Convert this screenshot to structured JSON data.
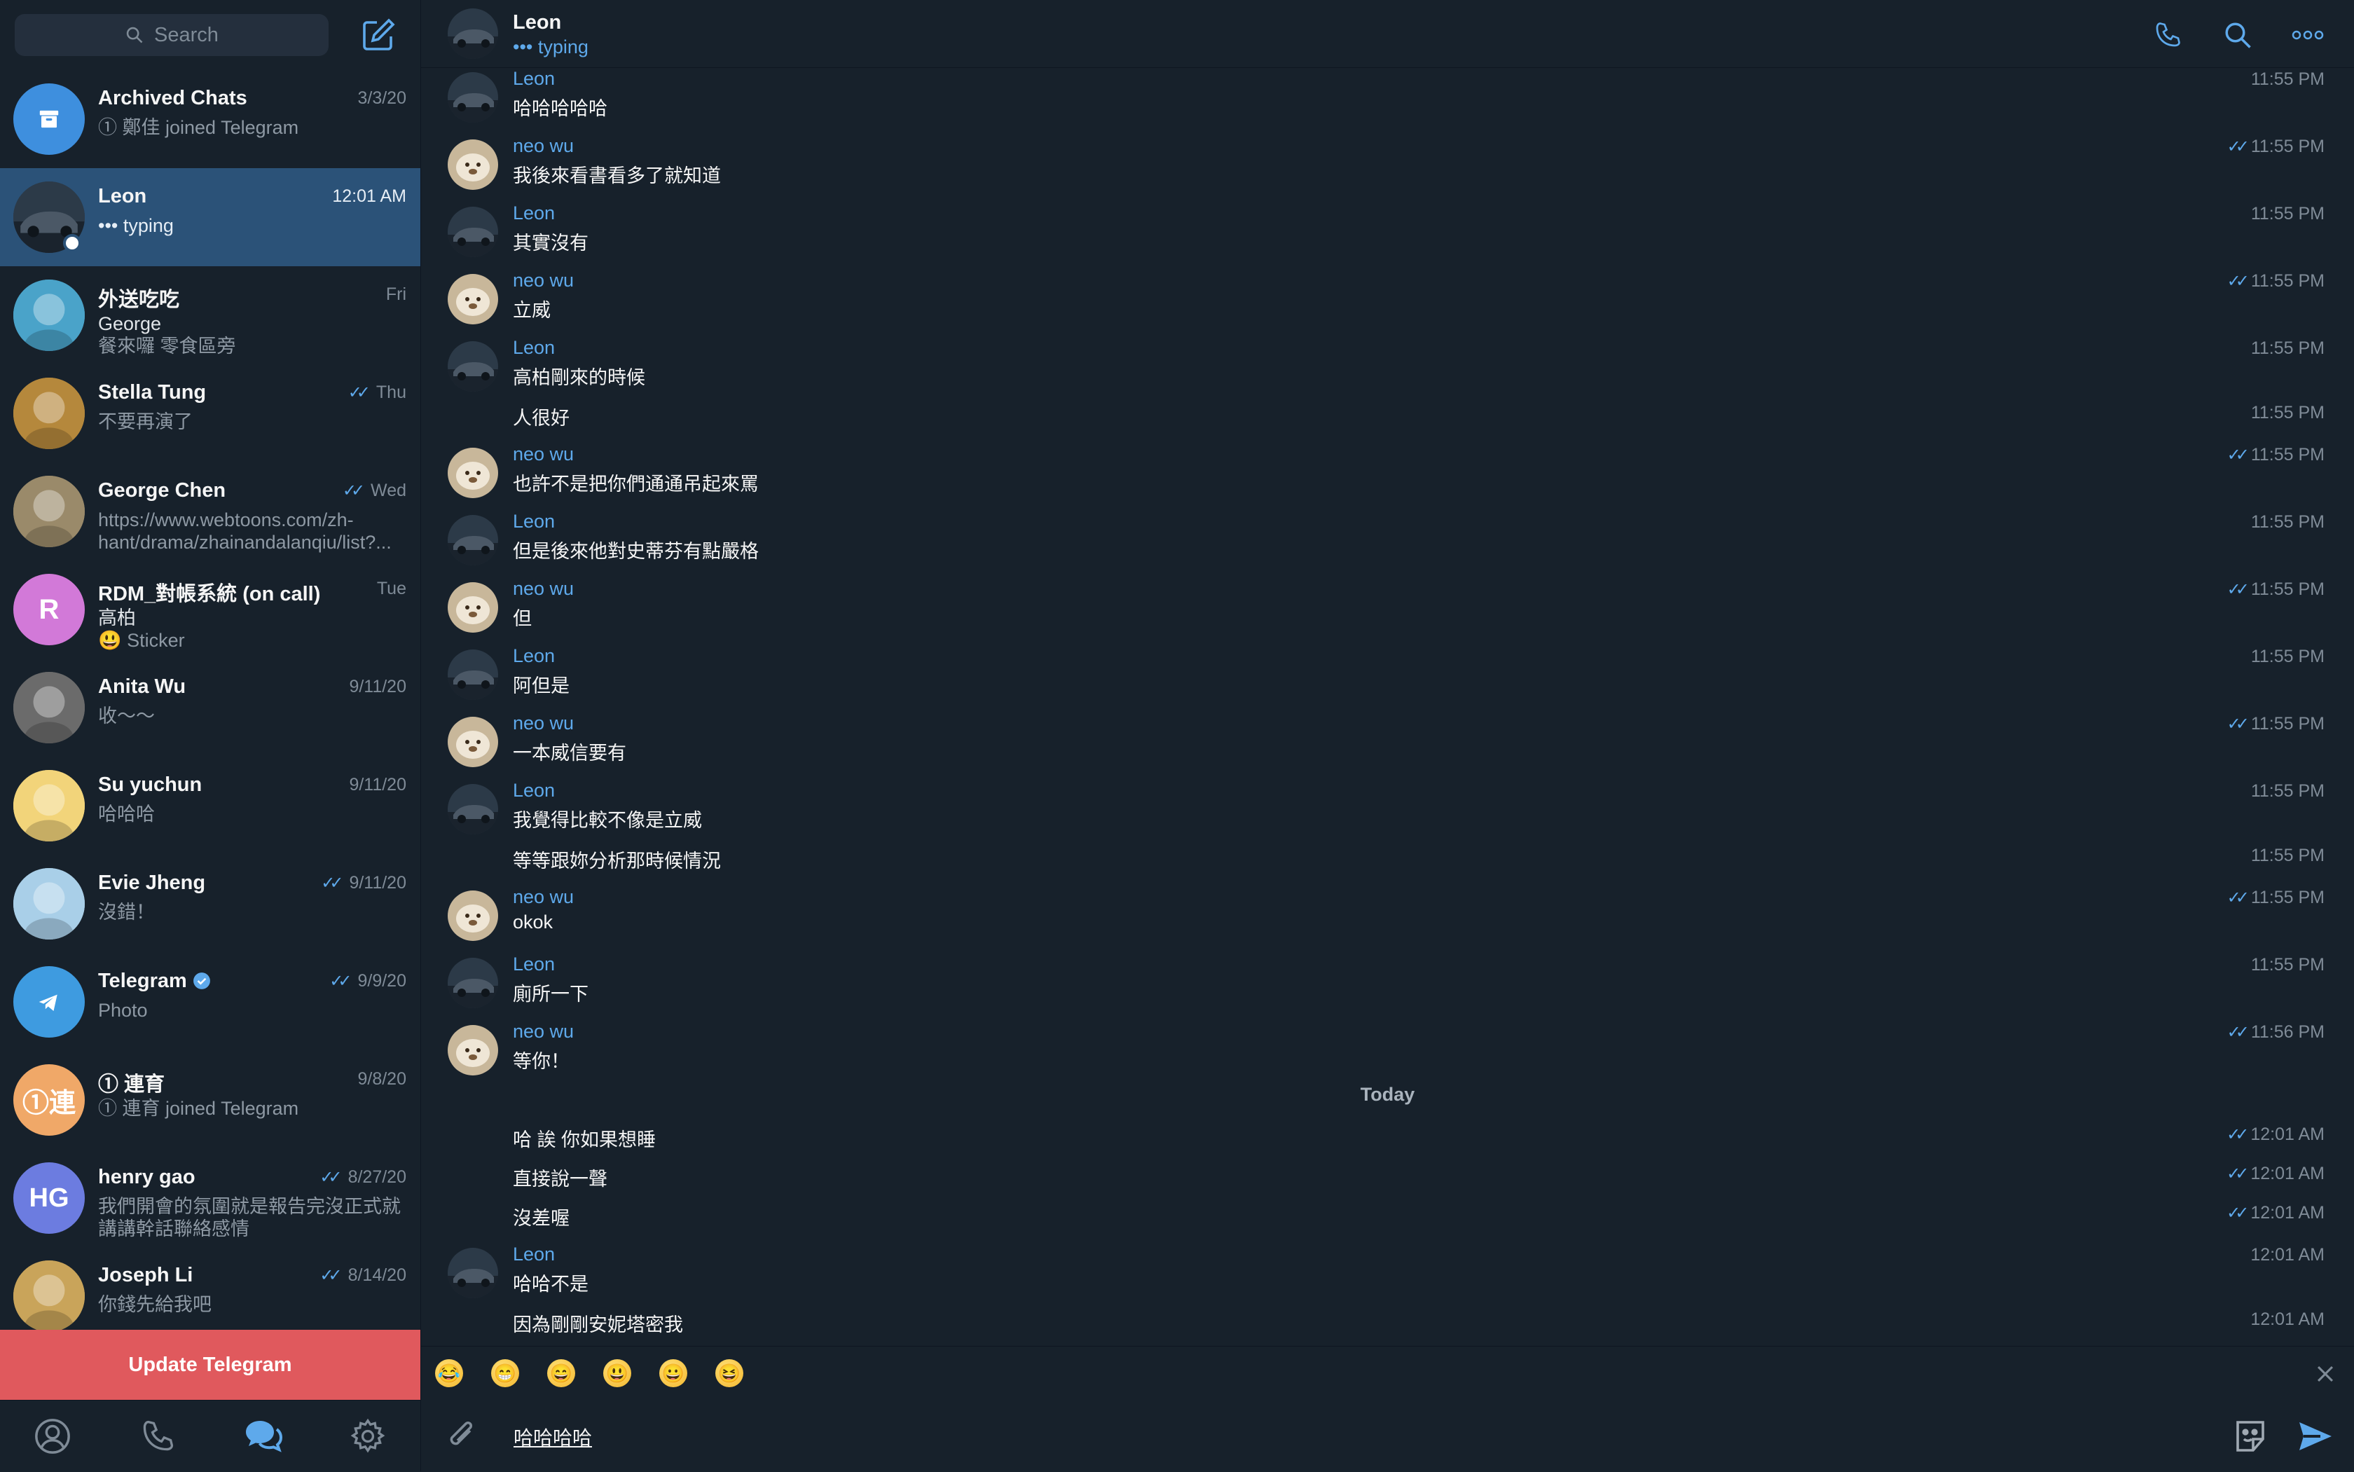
{
  "sidebar": {
    "search_placeholder": "Search",
    "update_button": "Update Telegram",
    "chats": [
      {
        "name": "Archived Chats",
        "date": "3/3/20",
        "preview": "① 鄭佳 joined Telegram",
        "sender": "",
        "read": false,
        "avatar_color": "#3e8fde",
        "avatar_text": "",
        "avatar_icon": "archive-icon"
      },
      {
        "name": "Leon",
        "date": "12:01 AM",
        "preview": "••• typing",
        "sender": "",
        "read": false,
        "avatar_color": "#2c3a48",
        "avatar_text": "",
        "avatar_icon": "car-photo",
        "active": true,
        "online": true
      },
      {
        "name": "外送吃吃",
        "date": "Fri",
        "preview": "餐來囉 零食區旁",
        "sender": "George",
        "read": false,
        "avatar_color": "#4aa3c9",
        "avatar_text": "",
        "avatar_icon": "cartoon-photo"
      },
      {
        "name": "Stella Tung",
        "date": "Thu",
        "preview": "不要再演了",
        "sender": "",
        "read": true,
        "avatar_color": "#b5883c",
        "avatar_text": "",
        "avatar_icon": "dog-photo"
      },
      {
        "name": "George Chen",
        "date": "Wed",
        "preview": "https://www.webtoons.com/zh-hant/drama/zhainandalanqiu/list?...",
        "sender": "",
        "read": true,
        "avatar_color": "#9a8a6a",
        "avatar_text": "",
        "avatar_icon": "pug-photo"
      },
      {
        "name": "RDM_對帳系統 (on call)",
        "date": "Tue",
        "preview": "😃 Sticker",
        "sender": "高柏",
        "read": false,
        "avatar_color": "#d279d8",
        "avatar_text": "R",
        "avatar_icon": ""
      },
      {
        "name": "Anita Wu",
        "date": "9/11/20",
        "preview": "收～～",
        "sender": "",
        "read": false,
        "avatar_color": "#6b6b6b",
        "avatar_text": "",
        "avatar_icon": "sketch-photo"
      },
      {
        "name": "Su yuchun",
        "date": "9/11/20",
        "preview": "哈哈哈",
        "sender": "",
        "read": false,
        "avatar_color": "#f2d47a",
        "avatar_text": "",
        "avatar_icon": "bunny-photo"
      },
      {
        "name": "Evie Jheng",
        "date": "9/11/20",
        "preview": "沒錯！",
        "sender": "",
        "read": true,
        "avatar_color": "#a9cfe8",
        "avatar_text": "",
        "avatar_icon": "illustration-photo"
      },
      {
        "name": "Telegram",
        "date": "9/9/20",
        "preview": "Photo",
        "sender": "",
        "read": true,
        "avatar_color": "#3e9be0",
        "avatar_text": "",
        "avatar_icon": "telegram-icon",
        "verified": true
      },
      {
        "name": "① 連育",
        "date": "9/8/20",
        "preview": "① 連育 joined Telegram",
        "sender": "",
        "read": false,
        "avatar_color": "#f0a868",
        "avatar_text": "①連",
        "avatar_icon": ""
      },
      {
        "name": "henry gao",
        "date": "8/27/20",
        "preview": "我們開會的氛圍就是報告完沒正式就講講幹話聯絡感情",
        "sender": "",
        "read": true,
        "avatar_color": "#6c7ce0",
        "avatar_text": "HG",
        "avatar_icon": ""
      },
      {
        "name": "Joseph Li",
        "date": "8/14/20",
        "preview": "你錢先給我吧",
        "sender": "",
        "read": true,
        "avatar_color": "#c9a45a",
        "avatar_text": "",
        "avatar_icon": "ball-photo"
      }
    ]
  },
  "header": {
    "name": "Leon",
    "status": "••• typing"
  },
  "messages": [
    {
      "sender": "Leon",
      "text": "哈哈哈哈哈",
      "time": "11:55 PM",
      "read": false,
      "partial": true
    },
    {
      "sender": "neo wu",
      "text": "我後來看書看多了就知道",
      "time": "11:55 PM",
      "read": true
    },
    {
      "sender": "Leon",
      "text": "其實沒有",
      "time": "11:55 PM",
      "read": false
    },
    {
      "sender": "neo wu",
      "text": "立威",
      "time": "11:55 PM",
      "read": true
    },
    {
      "sender": "Leon",
      "text": "高柏剛來的時候",
      "time": "11:55 PM",
      "read": false
    },
    {
      "sender": "",
      "text": "人很好",
      "time": "11:55 PM",
      "read": false
    },
    {
      "sender": "neo wu",
      "text": "也許不是把你們通通吊起來罵",
      "time": "11:55 PM",
      "read": true
    },
    {
      "sender": "Leon",
      "text": "但是後來他對史蒂芬有點嚴格",
      "time": "11:55 PM",
      "read": false
    },
    {
      "sender": "neo wu",
      "text": "但",
      "time": "11:55 PM",
      "read": true
    },
    {
      "sender": "Leon",
      "text": "阿但是",
      "time": "11:55 PM",
      "read": false
    },
    {
      "sender": "neo wu",
      "text": "一本威信要有",
      "time": "11:55 PM",
      "read": true
    },
    {
      "sender": "Leon",
      "text": "我覺得比較不像是立威",
      "time": "11:55 PM",
      "read": false
    },
    {
      "sender": "",
      "text": "等等跟妳分析那時候情況",
      "time": "11:55 PM",
      "read": false
    },
    {
      "sender": "neo wu",
      "text": "okok",
      "time": "11:55 PM",
      "read": true
    },
    {
      "sender": "Leon",
      "text": "廁所一下",
      "time": "11:55 PM",
      "read": false
    },
    {
      "sender": "neo wu",
      "text": "等你！",
      "time": "11:56 PM",
      "read": true
    },
    {
      "sender": "",
      "text": "哈 誒 你如果想睡",
      "time": "12:01 AM",
      "read": true
    },
    {
      "sender": "",
      "text": "直接說一聲",
      "time": "12:01 AM",
      "read": true
    },
    {
      "sender": "",
      "text": "沒差喔",
      "time": "12:01 AM",
      "read": true
    },
    {
      "sender": "Leon",
      "text": "哈哈不是",
      "time": "12:01 AM",
      "read": false
    },
    {
      "sender": "",
      "text": "因為剛剛安妮塔密我",
      "time": "12:01 AM",
      "read": false
    }
  ],
  "date_separator": "Today",
  "emoji_suggestions": [
    "😂",
    "😁",
    "😄",
    "😃",
    "😀",
    "😆"
  ],
  "input": {
    "value": "哈哈哈哈"
  },
  "colors": {
    "accent": "#5ea9eb",
    "active_chat": "#2b5278",
    "update_banner": "#e0595d",
    "background": "#17212b"
  }
}
